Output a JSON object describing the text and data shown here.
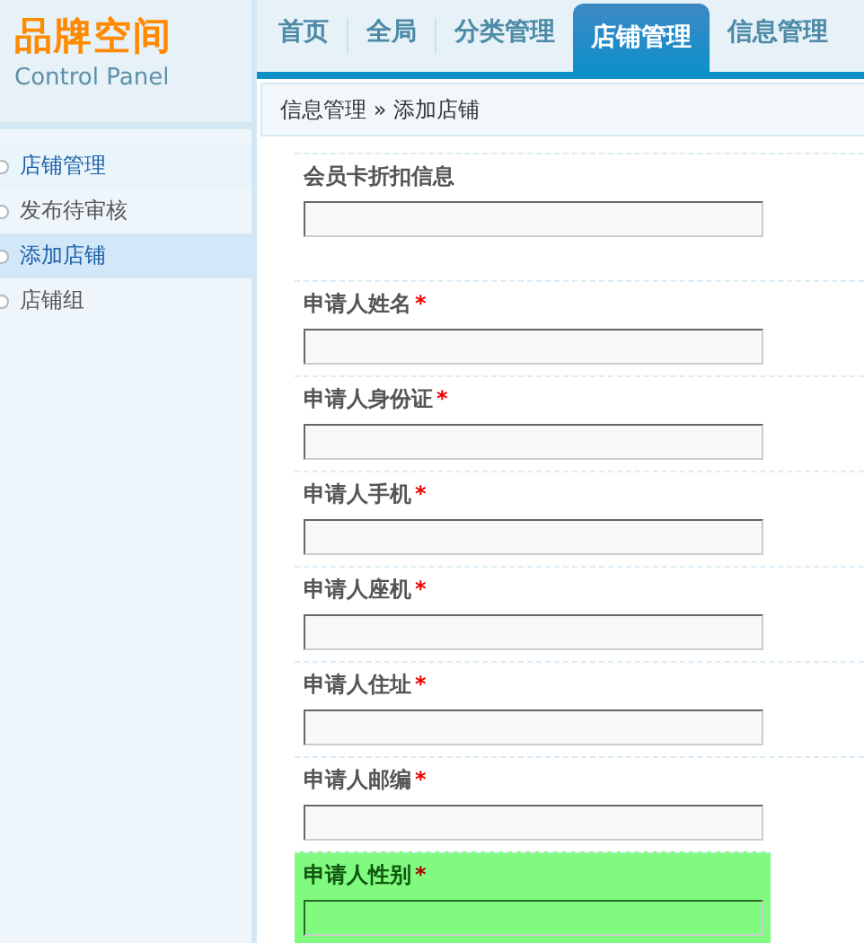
{
  "logo": {
    "title": "品牌空间",
    "subtitle": "Control Panel"
  },
  "tabs": [
    {
      "label": "首页",
      "selected": false
    },
    {
      "label": "全局",
      "selected": false
    },
    {
      "label": "分类管理",
      "selected": false
    },
    {
      "label": "店铺管理",
      "selected": true
    },
    {
      "label": "信息管理",
      "selected": false
    }
  ],
  "breadcrumb": {
    "path": "信息管理",
    "separator": "»",
    "current": "添加店铺"
  },
  "sidebar": {
    "items": [
      {
        "label": "店铺管理",
        "kind": "heading",
        "selected": false
      },
      {
        "label": "发布待审核",
        "kind": "item",
        "selected": false
      },
      {
        "label": "添加店铺",
        "kind": "item",
        "selected": true
      },
      {
        "label": "店铺组",
        "kind": "item",
        "selected": false
      }
    ]
  },
  "form": {
    "fields": [
      {
        "label": "会员卡折扣信息",
        "focused": false
      },
      {
        "label": "申请人姓名",
        "required_mark": "*",
        "focused": false
      },
      {
        "label": "申请人身份证",
        "required_mark": "*",
        "focused": false
      },
      {
        "label": "申请人手机",
        "required_mark": "*",
        "focused": false
      },
      {
        "label": "申请人座机",
        "required_mark": "*",
        "focused": false
      },
      {
        "label": "申请人住址",
        "required_mark": "*",
        "focused": false
      },
      {
        "label": "申请人邮编",
        "required_mark": "*",
        "focused": false
      },
      {
        "label": "申请人性别",
        "required_mark": "*",
        "focused": true
      }
    ]
  }
}
